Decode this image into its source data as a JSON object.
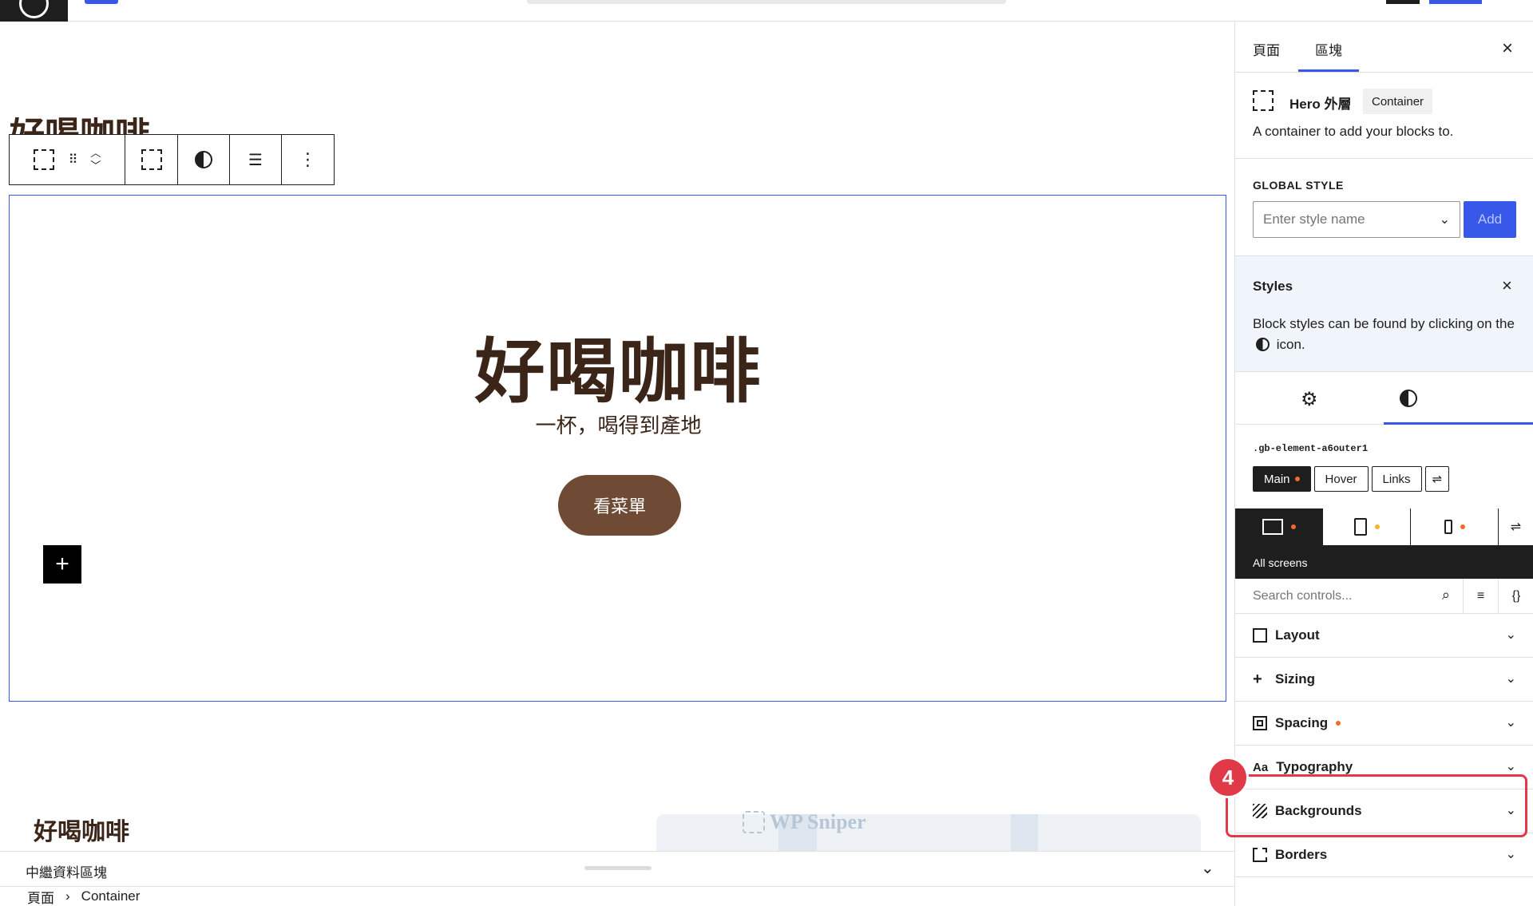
{
  "canvas": {
    "peek_title": "好喝咖啡",
    "hero": {
      "title": "好喝咖啡",
      "subtitle": "一杯，喝得到產地",
      "button": "看菜單"
    },
    "footer_title": "好喝咖啡",
    "watermark": "WP Sniper"
  },
  "meta_bar": {
    "label": "中繼資料區塊"
  },
  "breadcrumb": [
    "頁面",
    "Container"
  ],
  "sidebar": {
    "tabs": [
      "頁面",
      "區塊"
    ],
    "block": {
      "name": "Hero 外層",
      "badge": "Container",
      "description": "A container to add your blocks to."
    },
    "global_style": {
      "label": "GLOBAL STYLE",
      "placeholder": "Enter style name",
      "add_label": "Add"
    },
    "styles": {
      "title": "Styles",
      "text_before": "Block styles can be found by clicking on the",
      "text_after": "icon."
    },
    "selector": ".gb-element-a6outer1",
    "states": [
      "Main",
      "Hover",
      "Links"
    ],
    "all_screens": "All screens",
    "search_placeholder": "Search controls...",
    "panels": [
      "Layout",
      "Sizing",
      "Spacing",
      "Typography",
      "Backgrounds",
      "Borders"
    ],
    "step_number": "4"
  },
  "colors": {
    "accent": "#3858e9",
    "brand_brown": "#6f4a35",
    "highlight": "#e03a48",
    "dot_orange": "#f06b2b",
    "dot_yellow": "#f0b32b"
  }
}
